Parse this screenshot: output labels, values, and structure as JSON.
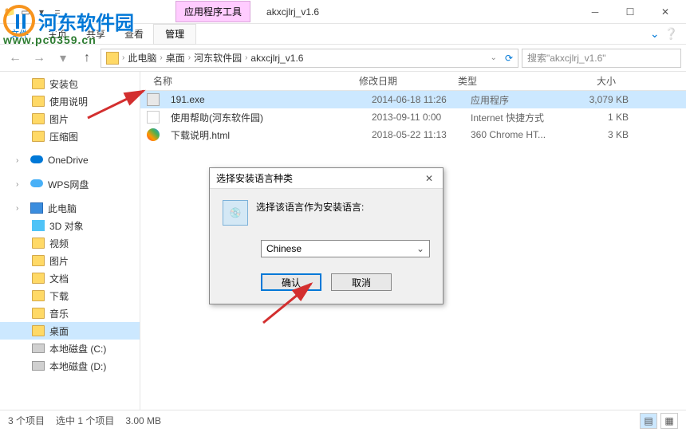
{
  "watermark": {
    "brand": "河东软件园",
    "url": "www.pc0359.cn"
  },
  "title": {
    "tool_group": "应用程序工具",
    "window": "akxcjlrj_v1.6"
  },
  "ribbon": {
    "file": "文件",
    "tabs": [
      "主页",
      "共享",
      "查看"
    ],
    "tool": "管理"
  },
  "breadcrumb": {
    "items": [
      "此电脑",
      "桌面",
      "河东软件园",
      "akxcjlrj_v1.6"
    ]
  },
  "search": {
    "placeholder": "搜索\"akxcjlrj_v1.6\""
  },
  "columns": {
    "name": "名称",
    "date": "修改日期",
    "type": "类型",
    "size": "大小"
  },
  "sidebar": {
    "items": [
      {
        "label": "安装包",
        "icon": "folder",
        "lvl": 2
      },
      {
        "label": "使用说明",
        "icon": "folder",
        "lvl": 2
      },
      {
        "label": "图片",
        "icon": "folder",
        "lvl": 2
      },
      {
        "label": "压缩图",
        "icon": "folder",
        "lvl": 2
      },
      {
        "label": "OneDrive",
        "icon": "cloud1",
        "lvl": 1,
        "exp": true
      },
      {
        "label": "WPS网盘",
        "icon": "cloud2",
        "lvl": 1,
        "exp": true
      },
      {
        "label": "此电脑",
        "icon": "pc",
        "lvl": 1,
        "exp": true
      },
      {
        "label": "3D 对象",
        "icon": "obj",
        "lvl": 2
      },
      {
        "label": "视频",
        "icon": "folder",
        "lvl": 2
      },
      {
        "label": "图片",
        "icon": "folder",
        "lvl": 2
      },
      {
        "label": "文档",
        "icon": "folder",
        "lvl": 2
      },
      {
        "label": "下载",
        "icon": "folder",
        "lvl": 2
      },
      {
        "label": "音乐",
        "icon": "folder",
        "lvl": 2
      },
      {
        "label": "桌面",
        "icon": "folder",
        "lvl": 2,
        "selected": true
      },
      {
        "label": "本地磁盘 (C:)",
        "icon": "drive",
        "lvl": 2
      },
      {
        "label": "本地磁盘 (D:)",
        "icon": "drive",
        "lvl": 2
      }
    ]
  },
  "files": [
    {
      "name": "191.exe",
      "date": "2014-06-18 11:26",
      "type": "应用程序",
      "size": "3,079 KB",
      "icon": "exe",
      "selected": true
    },
    {
      "name": "使用帮助(河东软件园)",
      "date": "2013-09-11 0:00",
      "type": "Internet 快捷方式",
      "size": "1 KB",
      "icon": "link"
    },
    {
      "name": "下载说明.html",
      "date": "2018-05-22 11:13",
      "type": "360 Chrome HT...",
      "size": "3 KB",
      "icon": "html"
    }
  ],
  "status": {
    "count": "3 个项目",
    "selected": "选中 1 个项目",
    "size": "3.00 MB"
  },
  "dialog": {
    "title": "选择安装语言种类",
    "message": "选择该语言作为安装语言:",
    "selected": "Chinese",
    "ok": "确认",
    "cancel": "取消"
  }
}
